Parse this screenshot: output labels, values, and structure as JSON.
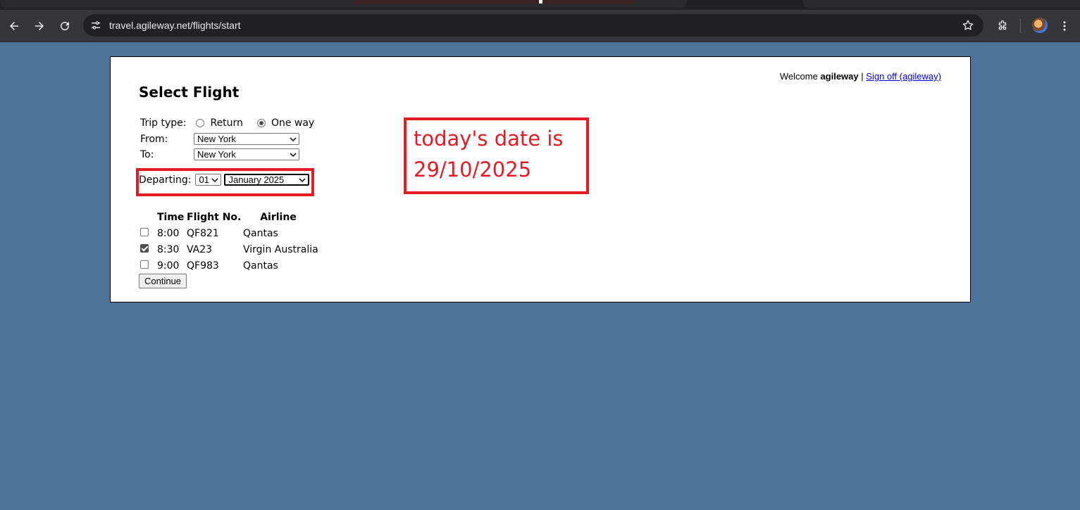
{
  "browser": {
    "url": "travel.agileway.net/flights/start"
  },
  "header": {
    "welcome_prefix": "Welcome",
    "username": "agileway",
    "sign_off": "Sign off (agileway)"
  },
  "page_title": "Select Flight",
  "trip_type": {
    "label": "Trip type:",
    "options": [
      "Return",
      "One way"
    ],
    "selected": "One way"
  },
  "from": {
    "label": "From:",
    "value": "New York"
  },
  "to": {
    "label": "To:",
    "value": "New York"
  },
  "departing": {
    "label": "Departing:",
    "day": "01",
    "month_year": "January 2025"
  },
  "annotation": {
    "line1": "today's date is",
    "line2": "29/10/2025",
    "color": "#e21b24"
  },
  "flights": {
    "headers": {
      "time": "Time",
      "flight_no": "Flight No.",
      "airline": "Airline"
    },
    "rows": [
      {
        "checked": false,
        "time": "8:00",
        "flight_no": "QF821",
        "airline": "Qantas"
      },
      {
        "checked": true,
        "time": "8:30",
        "flight_no": "VA23",
        "airline": "Virgin Australia"
      },
      {
        "checked": false,
        "time": "9:00",
        "flight_no": "QF983",
        "airline": "Qantas"
      }
    ]
  },
  "continue_label": "Continue",
  "colors": {
    "page_background": "#4d7399",
    "annotation_red": "#e21b24",
    "link": "#0000ee"
  }
}
